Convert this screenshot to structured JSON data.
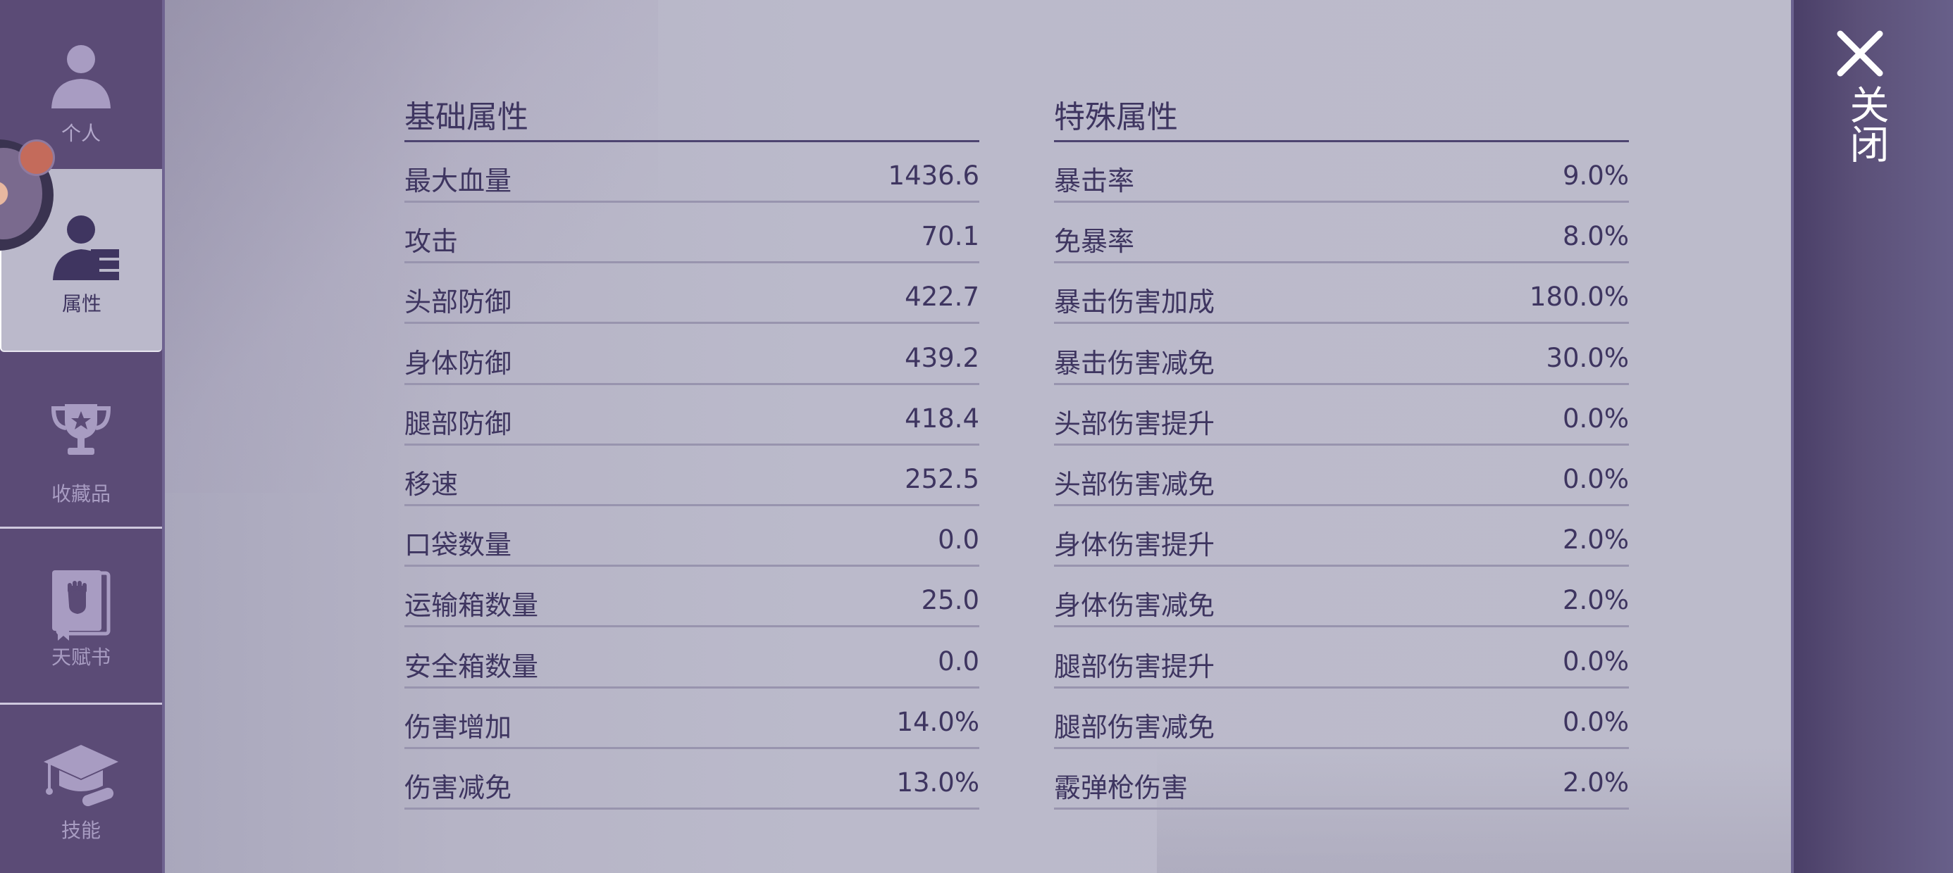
{
  "sidebar": {
    "items": [
      {
        "key": "profile",
        "label": "个人",
        "icon": "person-icon"
      },
      {
        "key": "attributes",
        "label": "属性",
        "icon": "person-card-icon",
        "active": true
      },
      {
        "key": "collection",
        "label": "收藏品",
        "icon": "trophy-icon"
      },
      {
        "key": "talent",
        "label": "天赋书",
        "icon": "fist-book-icon"
      },
      {
        "key": "skills",
        "label": "技能",
        "icon": "graduation-cap-icon"
      }
    ]
  },
  "basic": {
    "title": "基础属性",
    "rows": [
      {
        "name": "最大血量",
        "value": "1436.6"
      },
      {
        "name": "攻击",
        "value": "70.1"
      },
      {
        "name": "头部防御",
        "value": "422.7"
      },
      {
        "name": "身体防御",
        "value": "439.2"
      },
      {
        "name": "腿部防御",
        "value": "418.4"
      },
      {
        "name": "移速",
        "value": "252.5"
      },
      {
        "name": "口袋数量",
        "value": "0.0"
      },
      {
        "name": "运输箱数量",
        "value": "25.0"
      },
      {
        "name": "安全箱数量",
        "value": "0.0"
      },
      {
        "name": "伤害增加",
        "value": "14.0%"
      },
      {
        "name": "伤害减免",
        "value": "13.0%"
      }
    ]
  },
  "special": {
    "title": "特殊属性",
    "rows": [
      {
        "name": "暴击率",
        "value": "9.0%"
      },
      {
        "name": "免暴率",
        "value": "8.0%"
      },
      {
        "name": "暴击伤害加成",
        "value": "180.0%"
      },
      {
        "name": "暴击伤害减免",
        "value": "30.0%"
      },
      {
        "name": "头部伤害提升",
        "value": "0.0%"
      },
      {
        "name": "头部伤害减免",
        "value": "0.0%"
      },
      {
        "name": "身体伤害提升",
        "value": "2.0%"
      },
      {
        "name": "身体伤害减免",
        "value": "2.0%"
      },
      {
        "name": "腿部伤害提升",
        "value": "0.0%"
      },
      {
        "name": "腿部伤害减免",
        "value": "0.0%"
      },
      {
        "name": "霰弹枪伤害",
        "value": "2.0%"
      }
    ]
  },
  "close": {
    "label": "关闭",
    "icon": "close-icon"
  },
  "colors": {
    "sidebar": "#5b4b76",
    "panel": "#bbbacb",
    "text": "#3e3560",
    "close_panel": "#4a3f68"
  }
}
